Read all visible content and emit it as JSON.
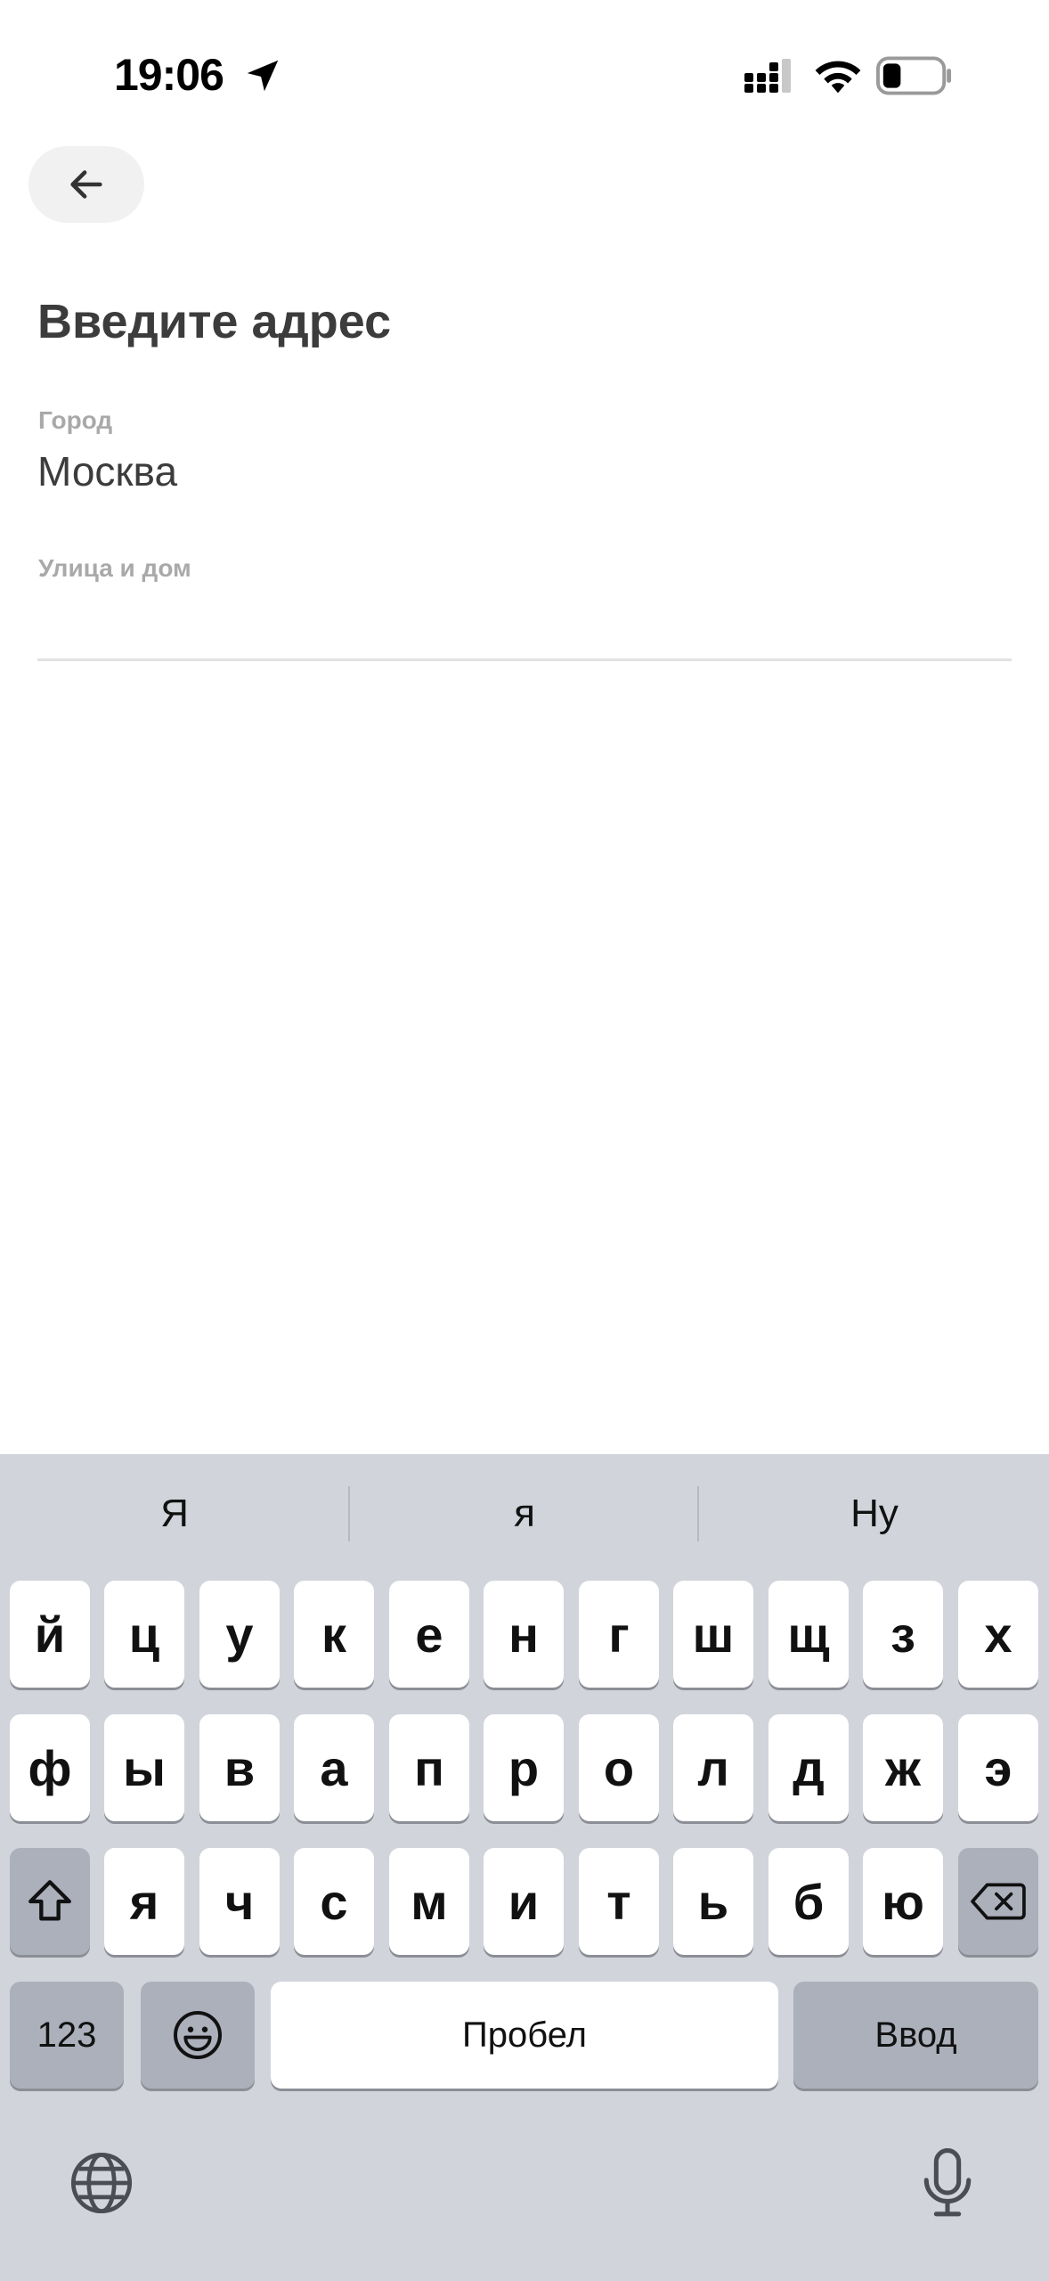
{
  "status_bar": {
    "time": "19:06",
    "icons": [
      "location-arrow-icon",
      "cellular-signal-icon",
      "wifi-icon",
      "battery-icon"
    ]
  },
  "header": {
    "back_icon": "arrow-left-icon",
    "title": "Введите адрес"
  },
  "form": {
    "city_label": "Город",
    "city_value": "Москва",
    "street_label": "Улица и дом",
    "street_value": ""
  },
  "keyboard": {
    "suggestions": [
      "Я",
      "я",
      "Ну"
    ],
    "row1": [
      "й",
      "ц",
      "у",
      "к",
      "е",
      "н",
      "г",
      "ш",
      "щ",
      "з",
      "х"
    ],
    "row2": [
      "ф",
      "ы",
      "в",
      "а",
      "п",
      "р",
      "о",
      "л",
      "д",
      "ж",
      "э"
    ],
    "row3": [
      "я",
      "ч",
      "с",
      "м",
      "и",
      "т",
      "ь",
      "б",
      "ю"
    ],
    "numbers_label": "123",
    "space_label": "Пробел",
    "return_label": "Ввод",
    "icons": [
      "shift-icon",
      "backspace-icon",
      "emoji-icon",
      "globe-icon",
      "microphone-icon"
    ]
  },
  "colors": {
    "keyboard_bg": "#d1d4db",
    "key_bg": "#ffffff",
    "key_dark_bg": "#abb0bb",
    "text_primary": "#3c3c3c",
    "text_label": "#a9a9a9"
  }
}
